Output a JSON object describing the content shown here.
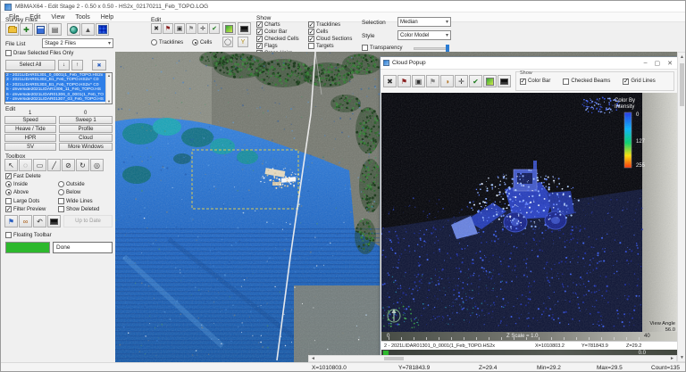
{
  "window": {
    "title": "MBMAX64 - Edit Stage 2 - 0.50 x 0.50 - HS2x_02170211_Feb_TOPO.LOG"
  },
  "menu": [
    "File",
    "Edit",
    "View",
    "Tools",
    "Help"
  ],
  "icons": {
    "delete": "✖",
    "flag": "⚑",
    "cell_edit": "▣",
    "expand": "✛",
    "accept": "✔",
    "add": "✚",
    "report": "▤",
    "gps": "▲",
    "circle_tool": "◑",
    "cursor": "↖",
    "poly_select": "◌",
    "rect_select": "▭",
    "line": "╱",
    "eraser": "⊘",
    "rotate": "↻",
    "zoom": "◎",
    "down": "↓",
    "up": "↑",
    "undo": "↶",
    "binoculars": "∞",
    "oval": "◯",
    "wiggle": "Y",
    "minimize": "–",
    "maximize": "▢",
    "close": "✕",
    "dropdown": "▾",
    "scroll_up": "▲",
    "scroll_down": "▼",
    "scroll_left": "◄",
    "scroll_right": "►"
  },
  "survey_files": {
    "label": "Survey Files",
    "file_list_label": "File List",
    "file_list_value": "Stage 2 Files",
    "draw_selected_label": "Draw Selected Files Only",
    "select_all_label": "Select All",
    "files": [
      "2 - 2021LIDAR01301_0_0001(1_Feb_TOPO.HS2x",
      "3 - 2021LIDAR01302_B1_Feb_TOPO.HS2x^ C0",
      "4 - 2021LIDAR01303_B1_Feb_TOPO.HS2x^ C0",
      "5 - driverside2021LIDAR1306_11_Feb_TOPO.HS",
      "6 - driverside2021LIDAR01306_0_0001(1_Feb_TO",
      "7 - driverside2021LIDAR01307_03_Feb_TOPO.HS"
    ]
  },
  "edit_group": {
    "label": "Edit",
    "tracklines_label": "Tracklines",
    "cells_label": "Cells"
  },
  "show_group": {
    "label": "Show",
    "col1": [
      "Charts",
      "Color Bar",
      "Checked Cells",
      "Flags",
      "Cross Hairs"
    ],
    "col2": [
      "Tracklines",
      "Cells",
      "Cloud Sections",
      "Targets"
    ]
  },
  "controls": {
    "selection_label": "Selection",
    "selection_value": "Median",
    "style_label": "Style",
    "style_value": "Color Model",
    "transparency_label": "Transparency"
  },
  "edit_panel": {
    "label": "Edit",
    "col1_header": "1",
    "col2_header": "0",
    "rows": [
      [
        "Speed",
        "Sweep 1"
      ],
      [
        "Heave / Tide",
        "Profile"
      ],
      [
        "HPR",
        "Cloud"
      ],
      [
        "SV",
        "More Windows"
      ]
    ]
  },
  "toolbox": {
    "label": "Toolbox",
    "fast_delete_label": "Fast Delete",
    "inside_label": "Inside",
    "outside_label": "Outside",
    "above_label": "Above",
    "below_label": "Below",
    "large_dots_label": "Large Dots",
    "wide_lines_label": "Wide Lines",
    "filter_preview_label": "Filter Preview",
    "show_deleted_label": "Show Deleted",
    "up_to_date_label": "Up to Date",
    "floating_toolbar_label": "Floating Toolbar",
    "done_label": "Done"
  },
  "cloud_popup": {
    "title": "Cloud Popup",
    "show_label": "Show",
    "color_bar_label": "Color Bar",
    "checked_beams_label": "Checked Beams",
    "grid_lines_label": "Grid Lines",
    "colorbar": {
      "title_line1": "Color By",
      "title_line2": "Intensity",
      "tick_top": "0",
      "tick_mid": "127",
      "tick_bottom": "255"
    },
    "scale_left": "0",
    "scale_label": "Z Scale = 1.0",
    "scale_right": "40",
    "view_angle_label": "View Angle",
    "view_angle_value": "56.0",
    "bottom_value": "0.0",
    "status_file": "2 - 2021LIDAR01301_0_0001(1_Feb_TOPO.HS2x",
    "status_x": "X=1010803.2",
    "status_y": "Y=781843.9",
    "status_z": "Z=29.2"
  },
  "status_bar": {
    "x": "X=1010803.0",
    "y": "Y=781843.9",
    "z": "Z=29.4",
    "min": "Min=29.2",
    "max": "Max=29.5",
    "count": "Count=135"
  }
}
